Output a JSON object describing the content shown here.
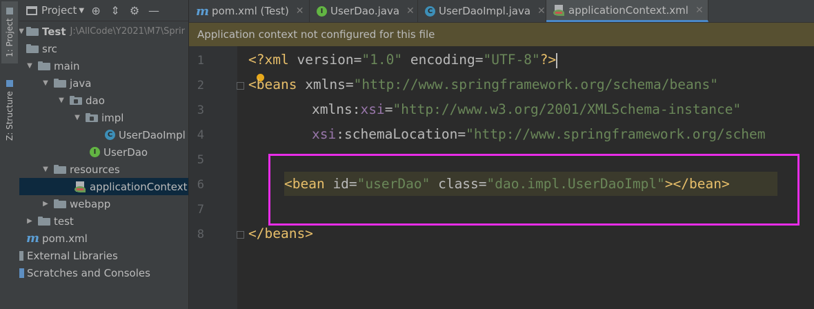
{
  "left_stripe": {
    "project_tab": "1: Project",
    "structure_tab": "Z: Structure"
  },
  "project_panel": {
    "title": "Project",
    "tree": [
      {
        "label": "Test",
        "path": "J:\\AllCode\\Y2021\\M7\\Sprir"
      },
      {
        "label": "src"
      },
      {
        "label": "main"
      },
      {
        "label": "java"
      },
      {
        "label": "dao"
      },
      {
        "label": "impl"
      },
      {
        "label": "UserDaoImpl"
      },
      {
        "label": "UserDao"
      },
      {
        "label": "resources"
      },
      {
        "label": "applicationContext."
      },
      {
        "label": "webapp"
      },
      {
        "label": "test"
      },
      {
        "label": "pom.xml"
      },
      {
        "label": "External Libraries"
      },
      {
        "label": "Scratches and Consoles"
      }
    ]
  },
  "tabs": [
    {
      "label": "pom.xml (Test)"
    },
    {
      "label": "UserDao.java"
    },
    {
      "label": "UserDaoImpl.java"
    },
    {
      "label": "applicationContext.xml"
    }
  ],
  "banner": {
    "message": "Application context not configured for this file"
  },
  "editor": {
    "line_numbers": [
      "1",
      "2",
      "3",
      "4",
      "5",
      "6",
      "7",
      "8"
    ],
    "code": {
      "l1_open": "<?",
      "l1_xml": "xml",
      "l1_version_attr": " version=",
      "l1_version_val": "\"1.0\"",
      "l1_enc_attr": " encoding=",
      "l1_enc_val": "\"UTF-8\"",
      "l1_close": "?>",
      "l2_tag": "<beans",
      "l2_attr": " xmlns=",
      "l2_val": "\"http://www.springframework.org/schema/beans\"",
      "l3_attr": "xmlns:",
      "l3_ns": "xsi",
      "l3_eq": "=",
      "l3_val": "\"http://www.w3.org/2001/XMLSchema-instance\"",
      "l4_ns": "xsi",
      "l4_attr": ":schemaLocation=",
      "l4_val": "\"http://www.springframework.org/schem",
      "l6_tag_open": "<bean",
      "l6_id_attr": " id=",
      "l6_id_val": "\"userDao\"",
      "l6_class_attr": " class=",
      "l6_class_val": "\"dao.impl.UserDaoImpl\"",
      "l6_close": "></bean>",
      "l8_tag": "</beans>"
    }
  },
  "colors": {
    "tag": "#e8bf6a",
    "string": "#6a8759",
    "namespace": "#9876aa",
    "highlight_box": "#e82de8",
    "banner_bg": "#575031"
  }
}
